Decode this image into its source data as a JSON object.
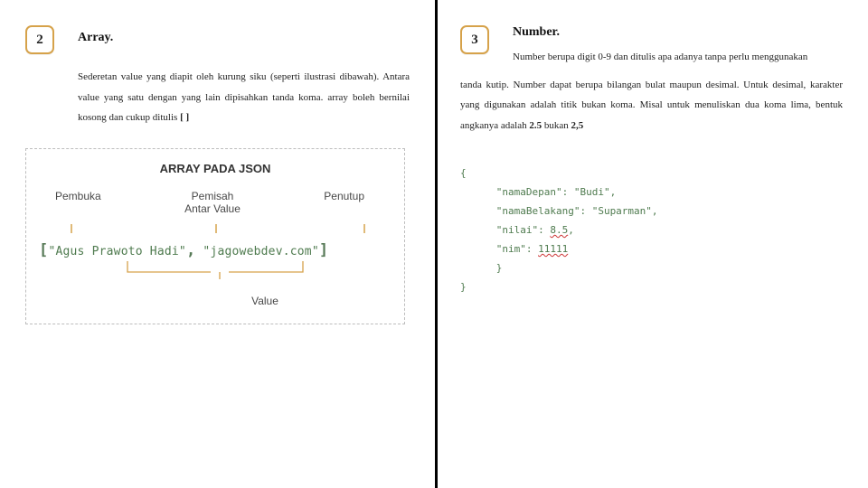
{
  "left": {
    "badge": "2",
    "title": "Array.",
    "body_a": "Sederetan value yang diapit oleh kurung siku (seperti ilustrasi dibawah). Antara value yang satu dengan yang lain dipisahkan tanda koma. array boleh bernilai kosong dan cukup ditulis ",
    "body_suffix": "[ ]"
  },
  "diagram": {
    "title": "ARRAY PADA JSON",
    "pembuka": "Pembuka",
    "pemisah_line1": "Pemisah",
    "pemisah_line2": "Antar Value",
    "penutup": "Penutup",
    "code_open": "[",
    "code_val1": "\"Agus Prawoto Hadi\"",
    "code_comma": ",",
    "code_val2": "\"jagowebdev.com\"",
    "code_close": "]",
    "value_label": "Value"
  },
  "right": {
    "badge": "3",
    "title": "Number.",
    "para_intro": "Number berupa digit 0-9 dan ditulis apa adanya tanpa perlu menggunakan",
    "para_rest_a": "tanda kutip. Number dapat berupa bilangan bulat maupun desimal. Untuk desimal, karakter yang digunakan adalah titik bukan koma. Misal untuk menuliskan dua koma lima, bentuk angkanya adalah ",
    "para_b1": "2.5",
    "para_mid": " bukan ",
    "para_b2": "2,5"
  },
  "code": {
    "l1": "{",
    "l2": "      \"namaDepan\": \"Budi\",",
    "l3": "      \"namaBelakang\": \"Suparman\",",
    "l4a": "      \"nilai\": ",
    "l4b": "8.5",
    "l4c": ",",
    "l5a": "      \"nim\": ",
    "l5b": "11111",
    "l6": "      }",
    "l7": "}"
  }
}
